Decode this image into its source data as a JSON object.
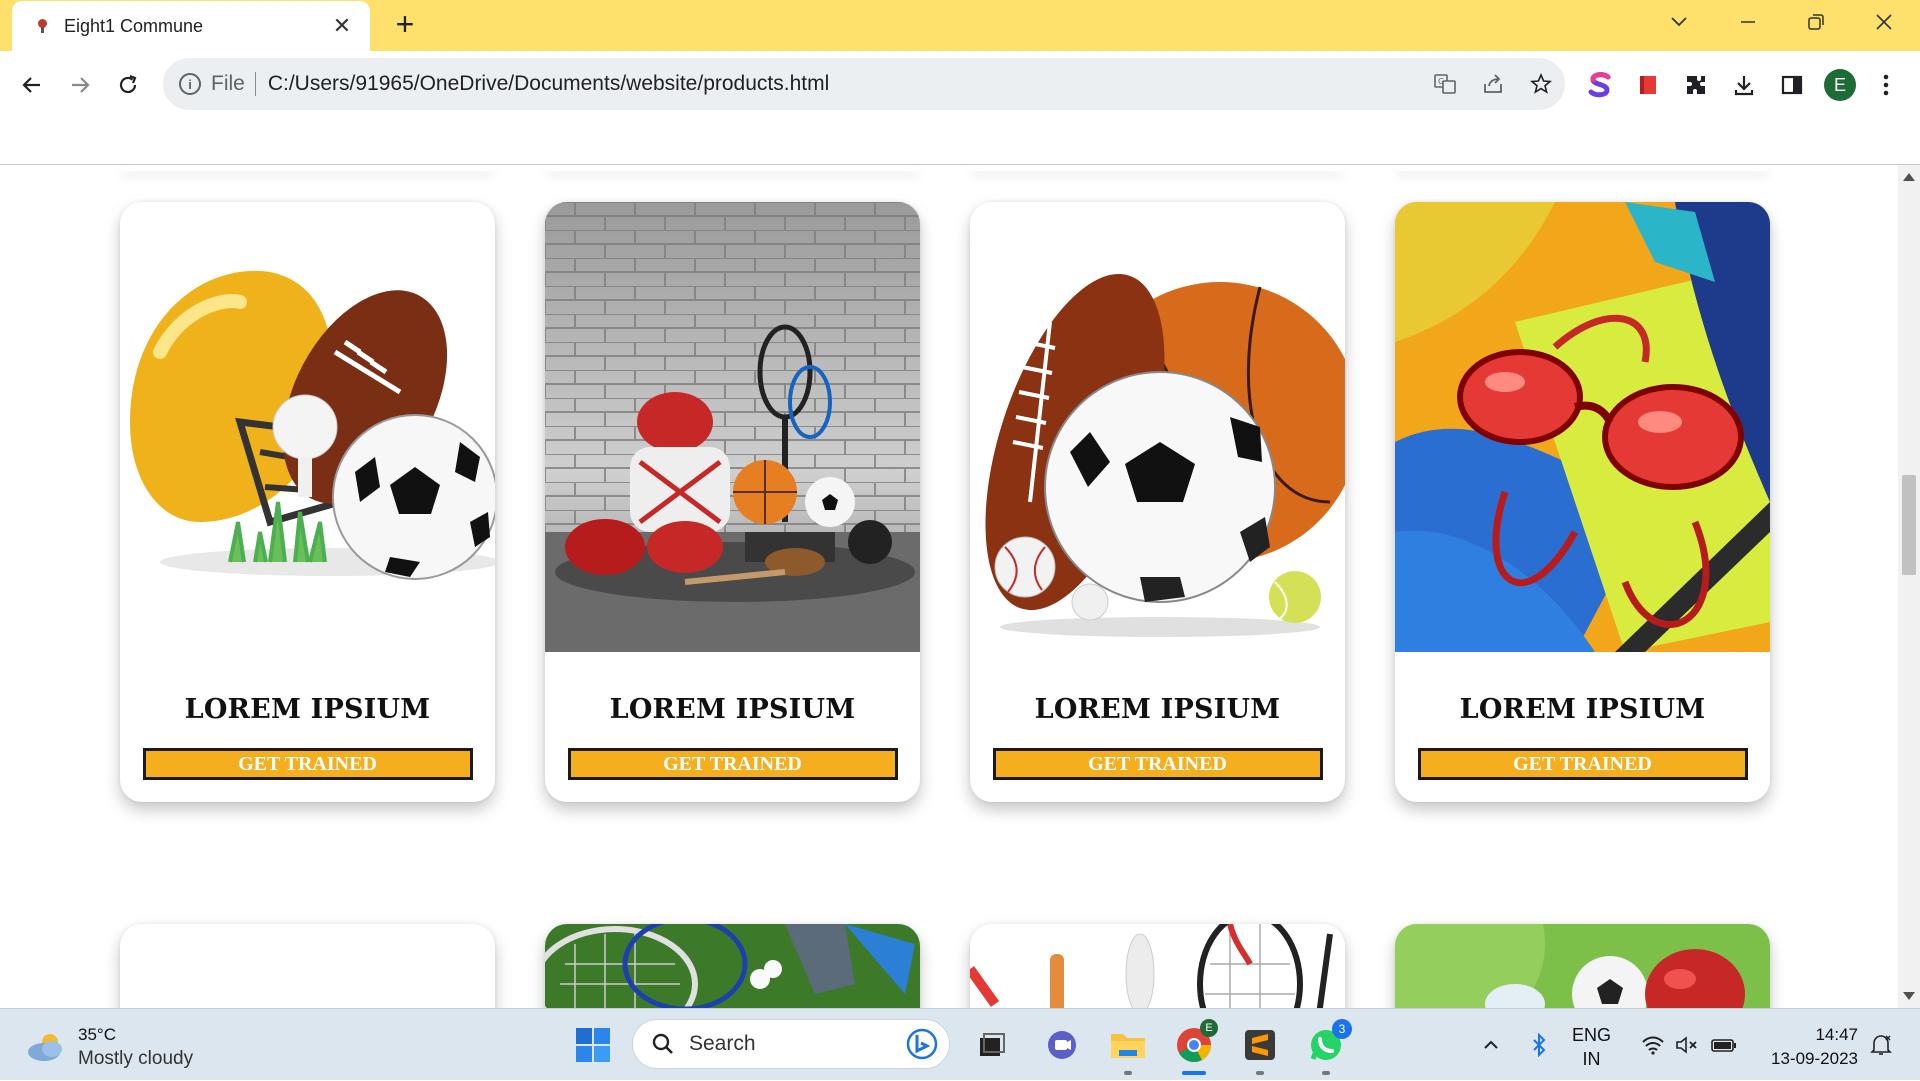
{
  "browser": {
    "tab_title": "Eight1 Commune",
    "new_tab_label": "+",
    "omnibox": {
      "scheme_label": "File",
      "url": "C:/Users/91965/OneDrive/Documents/website/products.html"
    },
    "profile_initial": "E",
    "colors": {
      "tabstrip": "#fde16c",
      "omnibox": "#eceff1"
    }
  },
  "page": {
    "cards": [
      {
        "title": "LOREM IPSIUM",
        "button": "GET TRAINED",
        "image": "helmet-football-golfball-soccerball"
      },
      {
        "title": "LOREM IPSIUM",
        "button": "GET TRAINED",
        "image": "sports-equipment-brick-wall"
      },
      {
        "title": "LOREM IPSIUM",
        "button": "GET TRAINED",
        "image": "rugby-soccer-basketball-balls"
      },
      {
        "title": "LOREM IPSIUM",
        "button": "GET TRAINED",
        "image": "red-swim-goggles"
      }
    ],
    "next_row_images": [
      "blank",
      "rackets-on-grass",
      "bat-pin-racket",
      "boxing-glove-ball"
    ],
    "colors": {
      "button_bg": "#f5ae1e",
      "button_border": "#1a1a1a"
    }
  },
  "taskbar": {
    "weather": {
      "temp": "35°C",
      "condition": "Mostly cloudy"
    },
    "search_label": "Search",
    "whatsapp_badge": "3",
    "chrome_badge": "E",
    "lang": {
      "line1": "ENG",
      "line2": "IN"
    },
    "clock": {
      "time": "14:47",
      "date": "13-09-2023"
    }
  }
}
